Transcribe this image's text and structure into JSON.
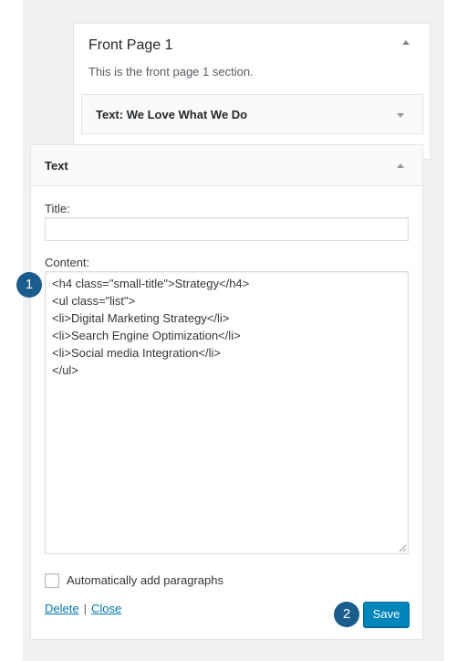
{
  "section": {
    "title": "Front Page 1",
    "description": "This is the front page 1 section."
  },
  "collapsed_widget": {
    "type_label": "Text",
    "title_suffix": ": We Love What We Do"
  },
  "widget": {
    "header_title": "Text",
    "title_label": "Title:",
    "title_value": "",
    "content_label": "Content:",
    "content_value": "<h4 class=\"small-title\">Strategy</h4>\n<ul class=\"list\">\n<li>Digital Marketing Strategy</li>\n<li>Search Engine Optimization</li>\n<li>Social media Integration</li>\n</ul>",
    "auto_paragraphs_label": "Automatically add paragraphs",
    "auto_paragraphs_checked": false,
    "delete_label": "Delete",
    "separator": "|",
    "close_label": "Close",
    "save_label": "Save"
  },
  "markers": {
    "content_marker": "1",
    "save_marker": "2"
  },
  "colors": {
    "accent": "#0085ba",
    "link": "#0073aa",
    "marker": "#1a5c8c"
  }
}
